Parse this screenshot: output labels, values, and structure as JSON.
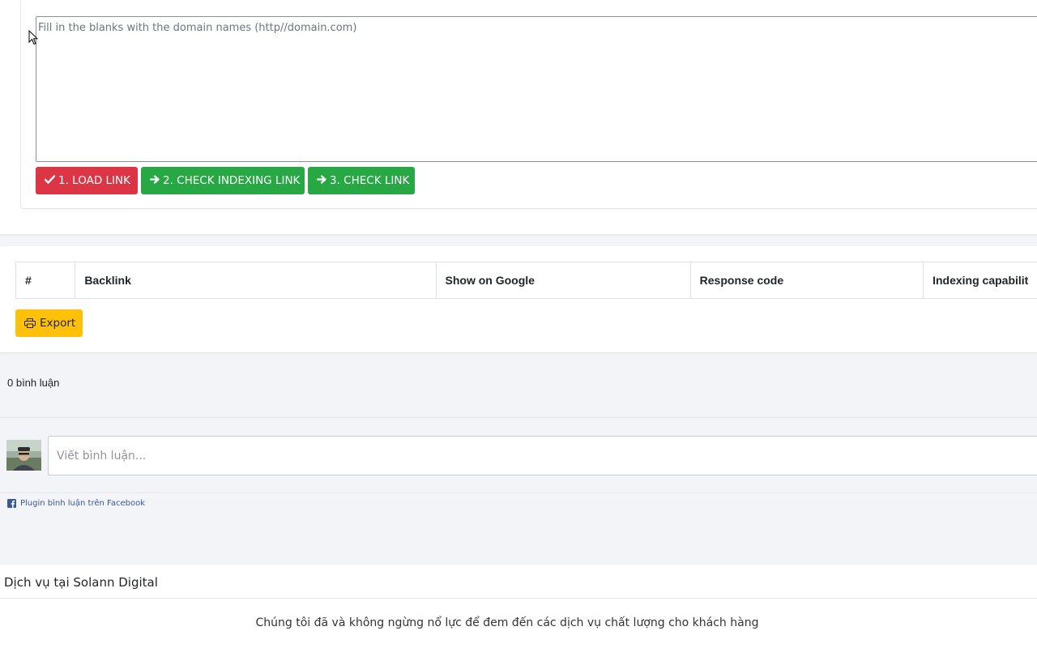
{
  "form": {
    "textarea_placeholder": "Fill in the blanks with the domain names (http//domain.com)",
    "buttons": [
      {
        "label": "1. LOAD LINK",
        "icon": "check-icon",
        "color": "#dc3545"
      },
      {
        "label": "2. CHECK INDEXING LINK",
        "icon": "arrow-right-icon",
        "color": "#28a745"
      },
      {
        "label": "3. CHECK LINK",
        "icon": "arrow-right-icon",
        "color": "#28a745"
      }
    ]
  },
  "results": {
    "columns": [
      "#",
      "Backlink",
      "Show on Google",
      "Response code",
      "Indexing capabilit"
    ],
    "export_label": "Export",
    "export_icon": "printer-icon",
    "export_color": "#ffc107"
  },
  "comments": {
    "count_label": "0 bình luận",
    "input_placeholder": "Viết bình luận...",
    "plugin_label": "Plugin bình luận trên Facebook"
  },
  "services": {
    "title": "Dịch vụ tại Solann Digital",
    "description": "Chúng tôi đã và không ngừng nổ lực để đem đến các dịch vụ chất lượng cho khách hàng"
  }
}
